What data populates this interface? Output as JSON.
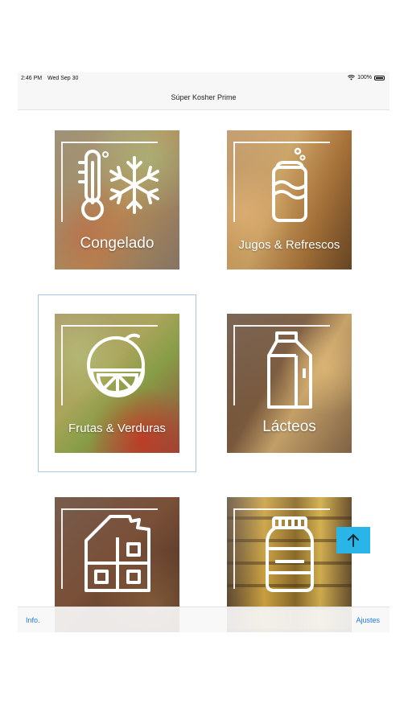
{
  "status_bar": {
    "time": "2:46 PM",
    "date": "Wed Sep 30",
    "battery": "100%"
  },
  "nav": {
    "title": "Súper Kosher Prime"
  },
  "categories": [
    {
      "label": "Congelado",
      "icon": "thermometer-snowflake-icon"
    },
    {
      "label": "Jugos & Refrescos",
      "icon": "soda-can-icon"
    },
    {
      "label": "Frutas & Verduras",
      "icon": "citrus-icon"
    },
    {
      "label": "Lácteos",
      "icon": "milk-carton-icon"
    },
    {
      "label": "",
      "icon": "chocolate-bar-icon"
    },
    {
      "label": "",
      "icon": "jar-icon"
    }
  ],
  "selected_category": "Frutas & Verduras",
  "tab_bar": {
    "left": "Info.",
    "right": "Ajustes"
  },
  "colors": {
    "accent": "#1e7cf0",
    "scroll_button": "#29b5e8"
  }
}
